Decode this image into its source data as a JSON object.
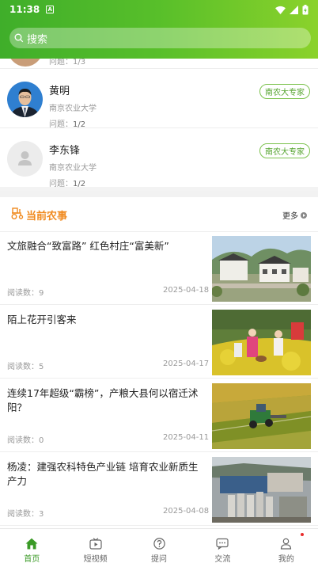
{
  "status": {
    "time": "11:38",
    "a_label": "A"
  },
  "search": {
    "placeholder": "搜索"
  },
  "experts": {
    "partial_stat": {
      "label": "问题：",
      "value": "1/3"
    },
    "items": [
      {
        "name": "黄明",
        "org": "南京农业大学",
        "stat_label": "问题：",
        "stat_value": "1/2",
        "tag": "南农大专家"
      },
      {
        "name": "李东锋",
        "org": "南京农业大学",
        "stat_label": "问题：",
        "stat_value": "1/2",
        "tag": "南农大专家"
      }
    ]
  },
  "news": {
    "title": "当前农事",
    "more_label": "更多",
    "items": [
      {
        "title": "文旅融合“致富路” 红色村庄“富美新”",
        "reads": "阅读数：9",
        "date": "2025-04-18"
      },
      {
        "title": "陌上花开引客来",
        "reads": "阅读数：5",
        "date": "2025-04-17"
      },
      {
        "title": "连续17年超级“霸榜”，产粮大县何以宿迁沭阳？",
        "reads": "阅读数：0",
        "date": "2025-04-11"
      },
      {
        "title": "杨凌：建强农科特色产业链 培育农业新质生产力",
        "reads": "阅读数：3",
        "date": "2025-04-08"
      }
    ]
  },
  "nav": {
    "items": [
      {
        "label": "首页",
        "icon": "home-icon",
        "active": true
      },
      {
        "label": "短视频",
        "icon": "video-icon"
      },
      {
        "label": "提问",
        "icon": "question-icon"
      },
      {
        "label": "交流",
        "icon": "chat-icon"
      },
      {
        "label": "我的",
        "icon": "user-icon"
      }
    ]
  },
  "colors": {
    "header_start": "#3fae2a",
    "header_end": "#8bd22b",
    "accent_orange": "#f08a1f",
    "tag_green": "#53a32d",
    "nav_active": "#3a9a26"
  }
}
